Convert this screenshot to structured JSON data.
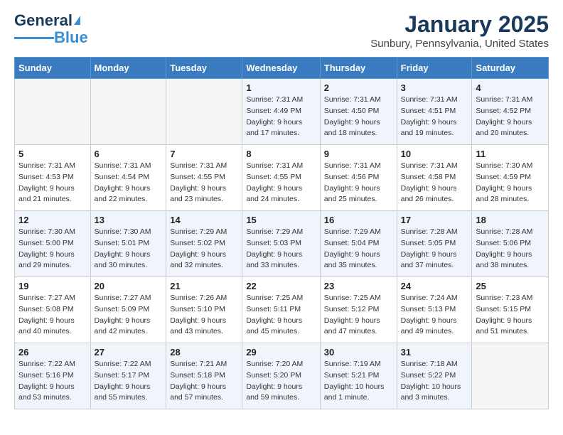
{
  "header": {
    "logo_general": "General",
    "logo_blue": "Blue",
    "title": "January 2025",
    "subtitle": "Sunbury, Pennsylvania, United States"
  },
  "days_of_week": [
    "Sunday",
    "Monday",
    "Tuesday",
    "Wednesday",
    "Thursday",
    "Friday",
    "Saturday"
  ],
  "weeks": [
    [
      {
        "day": "",
        "sunrise": "",
        "sunset": "",
        "daylight": ""
      },
      {
        "day": "",
        "sunrise": "",
        "sunset": "",
        "daylight": ""
      },
      {
        "day": "",
        "sunrise": "",
        "sunset": "",
        "daylight": ""
      },
      {
        "day": "1",
        "sunrise": "Sunrise: 7:31 AM",
        "sunset": "Sunset: 4:49 PM",
        "daylight": "Daylight: 9 hours and 17 minutes."
      },
      {
        "day": "2",
        "sunrise": "Sunrise: 7:31 AM",
        "sunset": "Sunset: 4:50 PM",
        "daylight": "Daylight: 9 hours and 18 minutes."
      },
      {
        "day": "3",
        "sunrise": "Sunrise: 7:31 AM",
        "sunset": "Sunset: 4:51 PM",
        "daylight": "Daylight: 9 hours and 19 minutes."
      },
      {
        "day": "4",
        "sunrise": "Sunrise: 7:31 AM",
        "sunset": "Sunset: 4:52 PM",
        "daylight": "Daylight: 9 hours and 20 minutes."
      }
    ],
    [
      {
        "day": "5",
        "sunrise": "Sunrise: 7:31 AM",
        "sunset": "Sunset: 4:53 PM",
        "daylight": "Daylight: 9 hours and 21 minutes."
      },
      {
        "day": "6",
        "sunrise": "Sunrise: 7:31 AM",
        "sunset": "Sunset: 4:54 PM",
        "daylight": "Daylight: 9 hours and 22 minutes."
      },
      {
        "day": "7",
        "sunrise": "Sunrise: 7:31 AM",
        "sunset": "Sunset: 4:55 PM",
        "daylight": "Daylight: 9 hours and 23 minutes."
      },
      {
        "day": "8",
        "sunrise": "Sunrise: 7:31 AM",
        "sunset": "Sunset: 4:55 PM",
        "daylight": "Daylight: 9 hours and 24 minutes."
      },
      {
        "day": "9",
        "sunrise": "Sunrise: 7:31 AM",
        "sunset": "Sunset: 4:56 PM",
        "daylight": "Daylight: 9 hours and 25 minutes."
      },
      {
        "day": "10",
        "sunrise": "Sunrise: 7:31 AM",
        "sunset": "Sunset: 4:58 PM",
        "daylight": "Daylight: 9 hours and 26 minutes."
      },
      {
        "day": "11",
        "sunrise": "Sunrise: 7:30 AM",
        "sunset": "Sunset: 4:59 PM",
        "daylight": "Daylight: 9 hours and 28 minutes."
      }
    ],
    [
      {
        "day": "12",
        "sunrise": "Sunrise: 7:30 AM",
        "sunset": "Sunset: 5:00 PM",
        "daylight": "Daylight: 9 hours and 29 minutes."
      },
      {
        "day": "13",
        "sunrise": "Sunrise: 7:30 AM",
        "sunset": "Sunset: 5:01 PM",
        "daylight": "Daylight: 9 hours and 30 minutes."
      },
      {
        "day": "14",
        "sunrise": "Sunrise: 7:29 AM",
        "sunset": "Sunset: 5:02 PM",
        "daylight": "Daylight: 9 hours and 32 minutes."
      },
      {
        "day": "15",
        "sunrise": "Sunrise: 7:29 AM",
        "sunset": "Sunset: 5:03 PM",
        "daylight": "Daylight: 9 hours and 33 minutes."
      },
      {
        "day": "16",
        "sunrise": "Sunrise: 7:29 AM",
        "sunset": "Sunset: 5:04 PM",
        "daylight": "Daylight: 9 hours and 35 minutes."
      },
      {
        "day": "17",
        "sunrise": "Sunrise: 7:28 AM",
        "sunset": "Sunset: 5:05 PM",
        "daylight": "Daylight: 9 hours and 37 minutes."
      },
      {
        "day": "18",
        "sunrise": "Sunrise: 7:28 AM",
        "sunset": "Sunset: 5:06 PM",
        "daylight": "Daylight: 9 hours and 38 minutes."
      }
    ],
    [
      {
        "day": "19",
        "sunrise": "Sunrise: 7:27 AM",
        "sunset": "Sunset: 5:08 PM",
        "daylight": "Daylight: 9 hours and 40 minutes."
      },
      {
        "day": "20",
        "sunrise": "Sunrise: 7:27 AM",
        "sunset": "Sunset: 5:09 PM",
        "daylight": "Daylight: 9 hours and 42 minutes."
      },
      {
        "day": "21",
        "sunrise": "Sunrise: 7:26 AM",
        "sunset": "Sunset: 5:10 PM",
        "daylight": "Daylight: 9 hours and 43 minutes."
      },
      {
        "day": "22",
        "sunrise": "Sunrise: 7:25 AM",
        "sunset": "Sunset: 5:11 PM",
        "daylight": "Daylight: 9 hours and 45 minutes."
      },
      {
        "day": "23",
        "sunrise": "Sunrise: 7:25 AM",
        "sunset": "Sunset: 5:12 PM",
        "daylight": "Daylight: 9 hours and 47 minutes."
      },
      {
        "day": "24",
        "sunrise": "Sunrise: 7:24 AM",
        "sunset": "Sunset: 5:13 PM",
        "daylight": "Daylight: 9 hours and 49 minutes."
      },
      {
        "day": "25",
        "sunrise": "Sunrise: 7:23 AM",
        "sunset": "Sunset: 5:15 PM",
        "daylight": "Daylight: 9 hours and 51 minutes."
      }
    ],
    [
      {
        "day": "26",
        "sunrise": "Sunrise: 7:22 AM",
        "sunset": "Sunset: 5:16 PM",
        "daylight": "Daylight: 9 hours and 53 minutes."
      },
      {
        "day": "27",
        "sunrise": "Sunrise: 7:22 AM",
        "sunset": "Sunset: 5:17 PM",
        "daylight": "Daylight: 9 hours and 55 minutes."
      },
      {
        "day": "28",
        "sunrise": "Sunrise: 7:21 AM",
        "sunset": "Sunset: 5:18 PM",
        "daylight": "Daylight: 9 hours and 57 minutes."
      },
      {
        "day": "29",
        "sunrise": "Sunrise: 7:20 AM",
        "sunset": "Sunset: 5:20 PM",
        "daylight": "Daylight: 9 hours and 59 minutes."
      },
      {
        "day": "30",
        "sunrise": "Sunrise: 7:19 AM",
        "sunset": "Sunset: 5:21 PM",
        "daylight": "Daylight: 10 hours and 1 minute."
      },
      {
        "day": "31",
        "sunrise": "Sunrise: 7:18 AM",
        "sunset": "Sunset: 5:22 PM",
        "daylight": "Daylight: 10 hours and 3 minutes."
      },
      {
        "day": "",
        "sunrise": "",
        "sunset": "",
        "daylight": ""
      }
    ]
  ]
}
